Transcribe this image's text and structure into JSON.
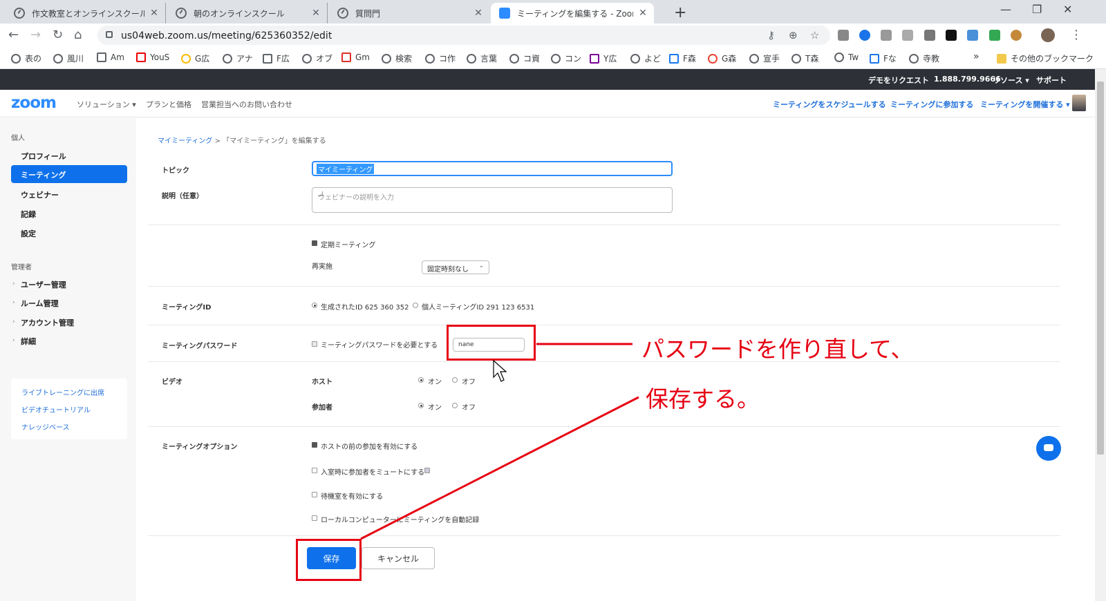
{
  "tabs": [
    {
      "label": "作文教室とオンラインスクールの営業"
    },
    {
      "label": "朝のオンラインスクール"
    },
    {
      "label": "質問門"
    },
    {
      "label": "ミーティングを編集する - Zoom"
    }
  ],
  "toolbar": {
    "url": "us04web.zoom.us/meeting/625360352/edit"
  },
  "bookmarks": [
    {
      "label": "表の"
    },
    {
      "label": "風川"
    },
    {
      "label": "Am"
    },
    {
      "label": "YouS"
    },
    {
      "label": "G広"
    },
    {
      "label": "アナ"
    },
    {
      "label": "F広"
    },
    {
      "label": "オブ"
    },
    {
      "label": "Gm"
    },
    {
      "label": "検索"
    },
    {
      "label": "コ作"
    },
    {
      "label": "言葉"
    },
    {
      "label": "コ資"
    },
    {
      "label": "コン"
    },
    {
      "label": "Y広"
    },
    {
      "label": "よど"
    },
    {
      "label": "F森"
    },
    {
      "label": "G森"
    },
    {
      "label": "宣手"
    },
    {
      "label": "T森"
    },
    {
      "label": "Tw"
    },
    {
      "label": "Fな"
    },
    {
      "label": "寺教"
    }
  ],
  "bookmarks_other": "その他のブックマーク",
  "topstrip": {
    "demo": "デモをリクエスト",
    "phone": "1.888.799.9666",
    "resources": "リソース ▾",
    "support": "サポート"
  },
  "header": {
    "logo": "zoom",
    "nav": [
      "ソリューション ▾",
      "プランと価格",
      "営業担当へのお問い合わせ"
    ],
    "right": [
      "ミーティングをスケジュールする",
      "ミーティングに参加する",
      "ミーティングを開催する ▾"
    ]
  },
  "sidebar": {
    "personal": "個人",
    "items": [
      "プロフィール",
      "ミーティング",
      "ウェビナー",
      "記録",
      "設定"
    ],
    "admin": "管理者",
    "admin_items": [
      "ユーザー管理",
      "ルーム管理",
      "アカウント管理",
      "詳細"
    ],
    "links": [
      "ライブトレーニングに出席",
      "ビデオチュートリアル",
      "ナレッジベース"
    ]
  },
  "breadcrumb": {
    "link": "マイミーティング",
    "sep": ">",
    "current": "「マイミーティング」を編集する"
  },
  "form": {
    "topic_label": "トピック",
    "topic_value": "マイミーティング",
    "desc_label": "説明（任意）",
    "desc_placeholder": "ウェビナーの説明を入力",
    "recurring": "定期ミーティング",
    "recurrence_label": "再実施",
    "recurrence_value": "固定時刻なし",
    "meeting_id_label": "ミーティングID",
    "id_generated": "生成されたID 625 360 352",
    "id_personal": "個人ミーティングID 291 123 6531",
    "password_label": "ミーティングパスワード",
    "password_require": "ミーティングパスワードを必要とする",
    "password_value": "nane",
    "video_label": "ビデオ",
    "host_label": "ホスト",
    "participants_label": "参加者",
    "on": "オン",
    "off": "オフ",
    "options_label": "ミーティングオプション",
    "opt_join_before_host": "ホストの前の参加を有効にする",
    "opt_mute": "入室時に参加者をミュートにする",
    "opt_waiting_room": "待機室を有効にする",
    "opt_record": "ローカルコンピューターにミーティングを自動記録",
    "save": "保存",
    "cancel": "キャンセル"
  },
  "annotations": {
    "text1": "パスワードを作り直して、",
    "text2": "保存する。",
    "color": "#e60012"
  }
}
